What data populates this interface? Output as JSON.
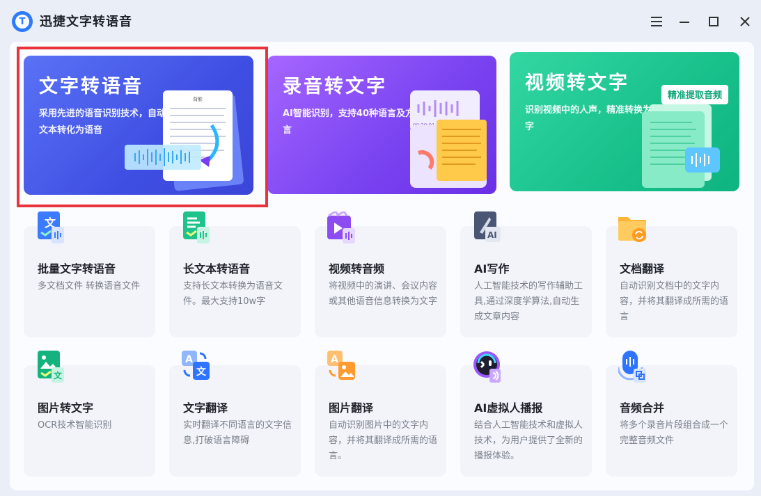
{
  "app": {
    "title": "迅捷文字转语音"
  },
  "banners": [
    {
      "title": "文字转语音",
      "desc": "采用先进的语音识别技术，自动将文本转化为语音"
    },
    {
      "title": "录音转文字",
      "desc": "AI智能识别，支持40种语言及方言"
    },
    {
      "title": "视频转文字",
      "desc": "识别视频中的人声，精准转换为文字",
      "tag": "精准提取音频"
    }
  ],
  "cards": [
    {
      "title": "批量文字转语音",
      "desc": "多文档文件 转换语音文件",
      "icon": "batch-text-to-speech-icon"
    },
    {
      "title": "长文本转语音",
      "desc": "支持长文本转换为语音文件。最大支持10w字",
      "icon": "long-text-icon"
    },
    {
      "title": "视频转音频",
      "desc": "将视频中的演讲、会议内容或其他语音信息转换为文字",
      "icon": "video-to-audio-icon"
    },
    {
      "title": "AI写作",
      "desc": "人工智能技术的写作辅助工具,通过深度学算法,自动生成文章内容",
      "icon": "ai-writing-icon"
    },
    {
      "title": "文档翻译",
      "desc": "自动识别文档中的文字内容，并将其翻译成所需的语言",
      "icon": "document-translate-icon"
    },
    {
      "title": "图片转文字",
      "desc": "OCR技术智能识别",
      "icon": "image-to-text-icon"
    },
    {
      "title": "文字翻译",
      "desc": "实时翻译不同语言的文字信息,打破语言障碍",
      "icon": "text-translate-icon"
    },
    {
      "title": "图片翻译",
      "desc": "自动识别图片中的文字内容，并将其翻译成所需的语言。",
      "icon": "image-translate-icon"
    },
    {
      "title": "AI虚拟人播报",
      "desc": "结合人工智能技术和虚拟人技术，为用户提供了全新的播报体验。",
      "icon": "ai-avatar-icon"
    },
    {
      "title": "音频合并",
      "desc": "将多个录音片段组合成一个完整音频文件",
      "icon": "audio-merge-icon"
    }
  ],
  "illustration": {
    "timestamp": "00:20:01",
    "doc_heading": "背影"
  },
  "colors": {
    "selection": "#e8323c",
    "banner1": "#4451e6",
    "banner2": "#7b45f2",
    "banner3": "#18c08a"
  }
}
